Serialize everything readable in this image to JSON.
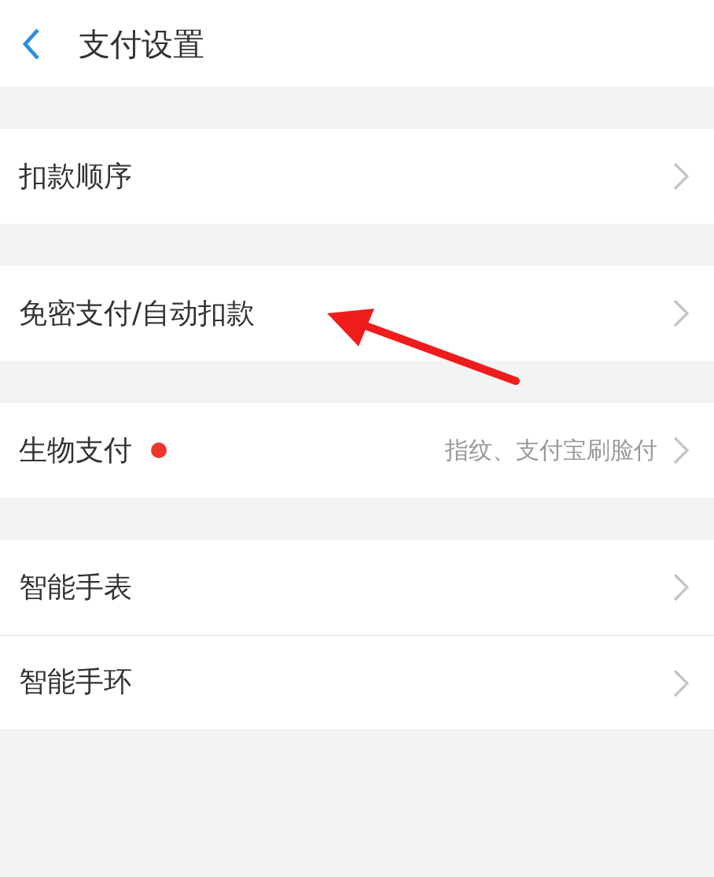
{
  "header": {
    "title": "支付设置"
  },
  "groups": [
    {
      "items": [
        {
          "label": "扣款顺序",
          "badge": false
        }
      ]
    },
    {
      "items": [
        {
          "label": "免密支付/自动扣款",
          "badge": false
        }
      ]
    },
    {
      "items": [
        {
          "label": "生物支付",
          "badge": true,
          "value": "指纹、支付宝刷脸付"
        }
      ]
    },
    {
      "items": [
        {
          "label": "智能手表",
          "badge": false
        },
        {
          "label": "智能手环",
          "badge": false
        }
      ]
    }
  ]
}
